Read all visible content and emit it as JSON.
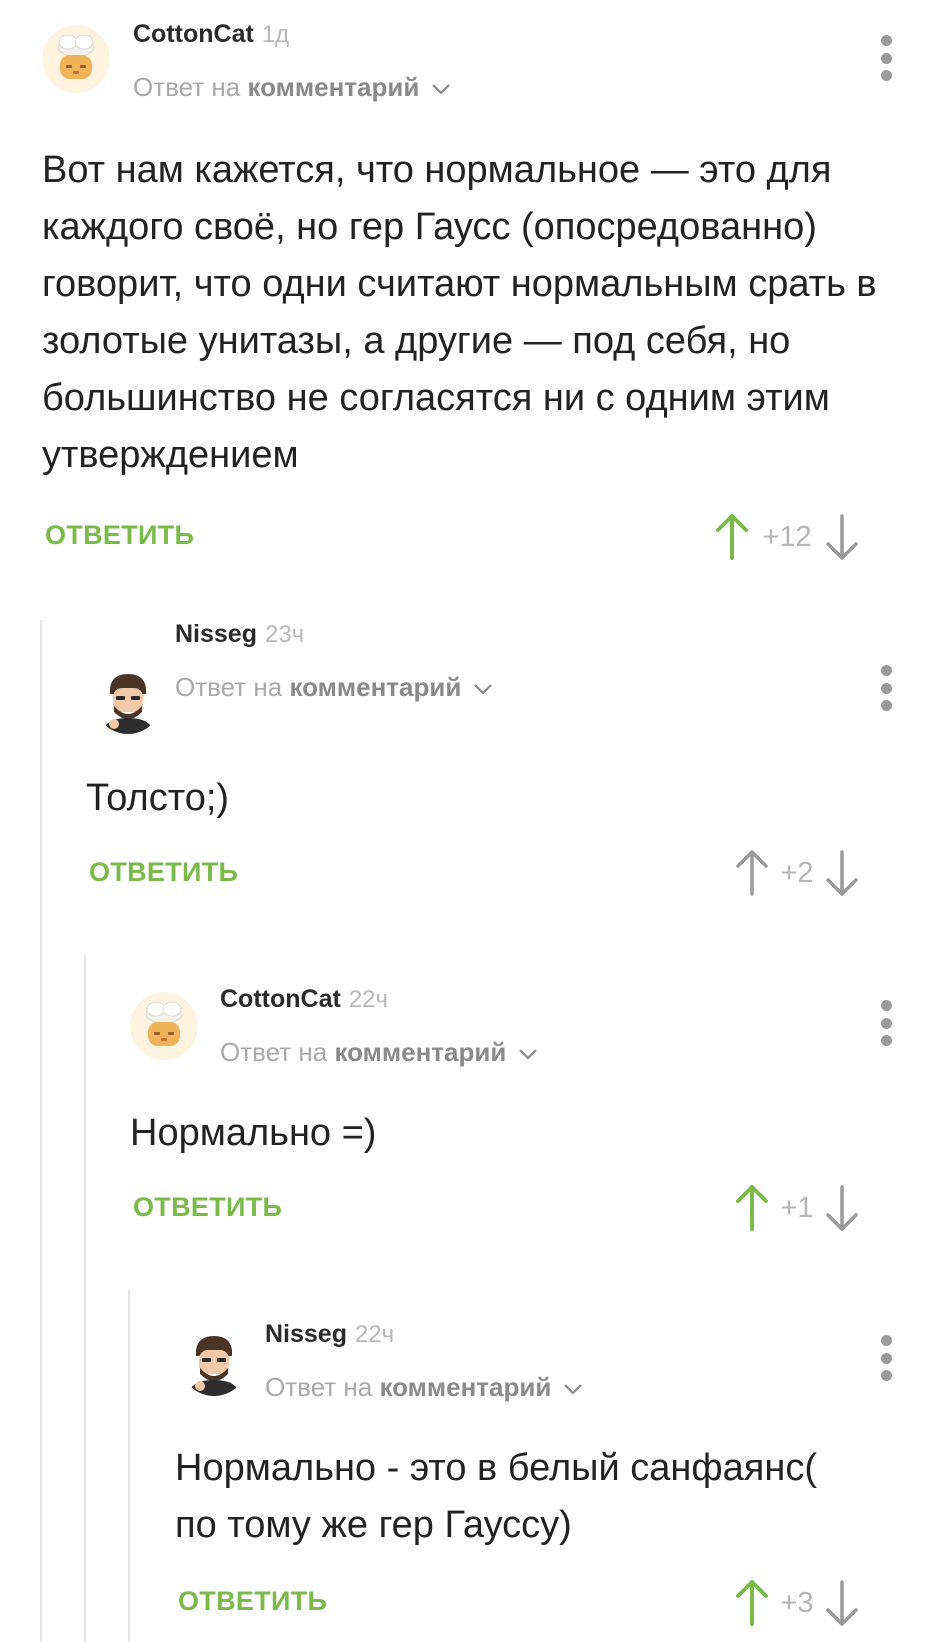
{
  "colors": {
    "accent_green": "#7bb94a",
    "upvote_active": "#7bb94a",
    "upvote_inactive": "#9a9a9a",
    "downvote": "#9a9a9a",
    "muted_text": "#a9a9a9",
    "thread_line": "#e6e6e6"
  },
  "comments": [
    {
      "username": "CottonCat",
      "time": "1д",
      "reply_prefix": "Ответ на",
      "reply_target": "комментарий",
      "text": "Вот нам кажется, что нормальное — это для каждого своё, но гер Гаусс (опосредованно) говорит, что одни считают нормальным срать в золотые унитазы, а другие — под себя, но большинство не согласятся ни с одним этим утверждением",
      "reply_label": "ОТВЕТИТЬ",
      "score": "+12",
      "upvoted": true,
      "avatar": "cotton-cat-avatar"
    },
    {
      "username": "Nisseg",
      "time": "23ч",
      "reply_prefix": "Ответ на",
      "reply_target": "комментарий",
      "text": "Толсто;)",
      "reply_label": "ОТВЕТИТЬ",
      "score": "+2",
      "upvoted": false,
      "avatar": "nisseg-avatar"
    },
    {
      "username": "CottonCat",
      "time": "22ч",
      "reply_prefix": "Ответ на",
      "reply_target": "комментарий",
      "text": "Нормально =)",
      "reply_label": "ОТВЕТИТЬ",
      "score": "+1",
      "upvoted": true,
      "avatar": "cotton-cat-avatar"
    },
    {
      "username": "Nisseg",
      "time": "22ч",
      "reply_prefix": "Ответ на",
      "reply_target": "комментарий",
      "text": "Нормально - это в белый санфаянс( по тому же гер Гауссу)",
      "reply_label": "ОТВЕТИТЬ",
      "score": "+3",
      "upvoted": true,
      "avatar": "nisseg-avatar"
    }
  ]
}
